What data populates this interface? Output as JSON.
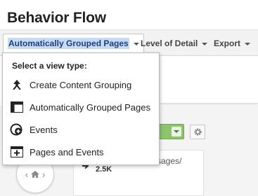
{
  "page": {
    "title": "Behavior Flow"
  },
  "toolbar": {
    "view_type_label": "Automatically Grouped Pages",
    "level_of_detail_label": "Level of Detail",
    "export_label": "Export"
  },
  "dropdown": {
    "heading": "Select a view type:",
    "items": [
      {
        "label": "Create Content Grouping",
        "icon": "branch-arrow-icon"
      },
      {
        "label": "Automatically Grouped Pages",
        "icon": "grouped-pages-icon"
      },
      {
        "label": "Events",
        "icon": "events-icon"
      },
      {
        "label": "Pages and Events",
        "icon": "pages-and-events-icon"
      }
    ]
  },
  "flow": {
    "node_label_partial": "ssages/",
    "node_count": "2.5K"
  },
  "colors": {
    "selection_highlight": "#c6daf4",
    "green_control": "#8cc56b"
  }
}
